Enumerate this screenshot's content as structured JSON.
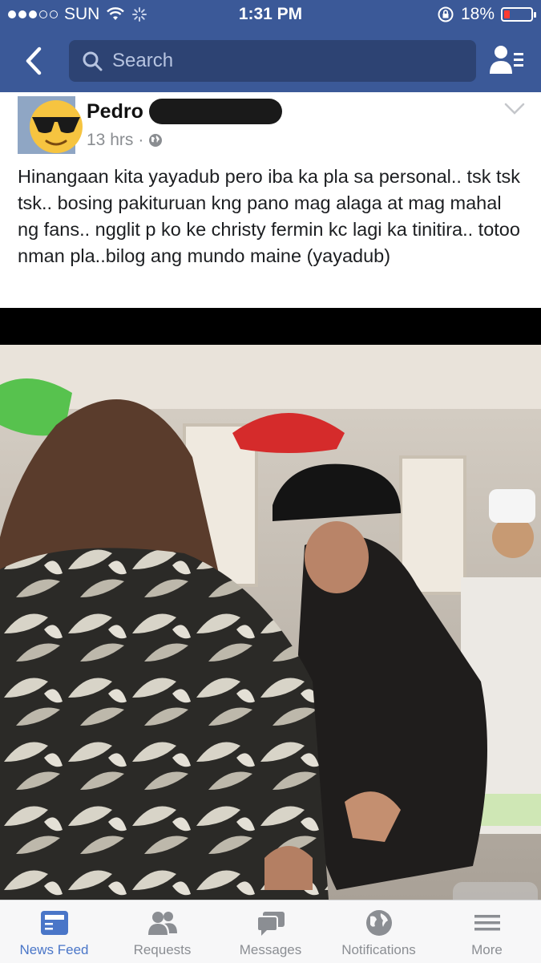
{
  "status_bar": {
    "carrier": "SUN",
    "time": "1:31 PM",
    "battery": "18%",
    "battery_level": 0.18
  },
  "nav": {
    "search_placeholder": "Search"
  },
  "post": {
    "author": "Pedro",
    "time": "13 hrs",
    "text": "Hinangaan kita yayadub pero iba ka pla sa personal.. tsk tsk tsk.. bosing pakituruan kng pano mag alaga at mag mahal ng fans.. ngglit p ko ke christy fermin kc lagi ka tinitira.. totoo nman pla..bilog ang mundo maine (yayadub)"
  },
  "tabs": [
    {
      "label": "News Feed",
      "icon": "news-feed-icon",
      "active": true
    },
    {
      "label": "Requests",
      "icon": "friend-requests-icon",
      "active": false
    },
    {
      "label": "Messages",
      "icon": "messages-icon",
      "active": false
    },
    {
      "label": "Notifications",
      "icon": "globe-icon",
      "active": false
    },
    {
      "label": "More",
      "icon": "menu-icon",
      "active": false
    }
  ],
  "colors": {
    "brand": "#3b5998",
    "active_tab": "#4a76c8",
    "inactive_tab": "#8b8e93"
  }
}
